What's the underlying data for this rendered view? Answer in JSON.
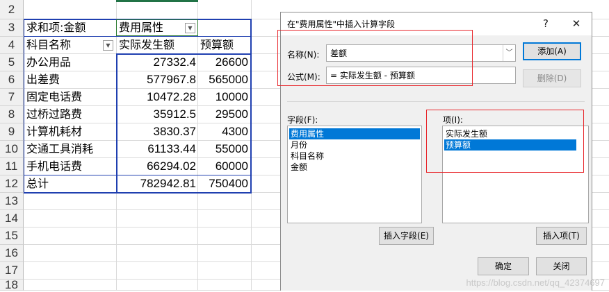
{
  "sheet": {
    "row_numbers": [
      "2",
      "3",
      "4",
      "5",
      "6",
      "7",
      "8",
      "9",
      "10",
      "11",
      "12",
      "13",
      "14",
      "15",
      "16",
      "17",
      "18"
    ],
    "pivot": {
      "sum_label": "求和项:金额",
      "column_field": "费用属性",
      "row_field": "科目名称",
      "col_headers": [
        "实际发生额",
        "预算额"
      ],
      "rows": [
        {
          "name": "办公用品",
          "actual": "27332.4",
          "budget": "26600"
        },
        {
          "name": "出差费",
          "actual": "577967.8",
          "budget": "565000"
        },
        {
          "name": "固定电话费",
          "actual": "10472.28",
          "budget": "10000"
        },
        {
          "name": "过桥过路费",
          "actual": "35912.5",
          "budget": "29500"
        },
        {
          "name": "计算机耗材",
          "actual": "3830.37",
          "budget": "4300"
        },
        {
          "name": "交通工具消耗",
          "actual": "61133.44",
          "budget": "55000"
        },
        {
          "name": "手机电话费",
          "actual": "66294.02",
          "budget": "60000"
        }
      ],
      "total": {
        "name": "总计",
        "actual": "782942.81",
        "budget": "750400"
      }
    }
  },
  "dialog": {
    "title": "在\"费用属性\"中插入计算字段",
    "help": "?",
    "close": "✕",
    "name_label": "名称(N):",
    "name_value": "差额",
    "formula_label": "公式(M):",
    "formula_value": "= 实际发生额 - 预算额",
    "add_button": "添加(A)",
    "delete_button": "删除(D)",
    "fields_label": "字段(F):",
    "fields": [
      "费用属性",
      "月份",
      "科目名称",
      "金额"
    ],
    "items_label": "项(I):",
    "items": [
      "实际发生额",
      "预算额"
    ],
    "insert_field_button": "插入字段(E)",
    "insert_item_button": "插入项(T)",
    "ok_button": "确定",
    "close_button": "关闭"
  },
  "watermark": "https://blog.csdn.net/qq_42374697",
  "colors": {
    "pivot_border": "#1f3fb0",
    "highlight_box": "#e8262b",
    "selection": "#0078d7"
  }
}
